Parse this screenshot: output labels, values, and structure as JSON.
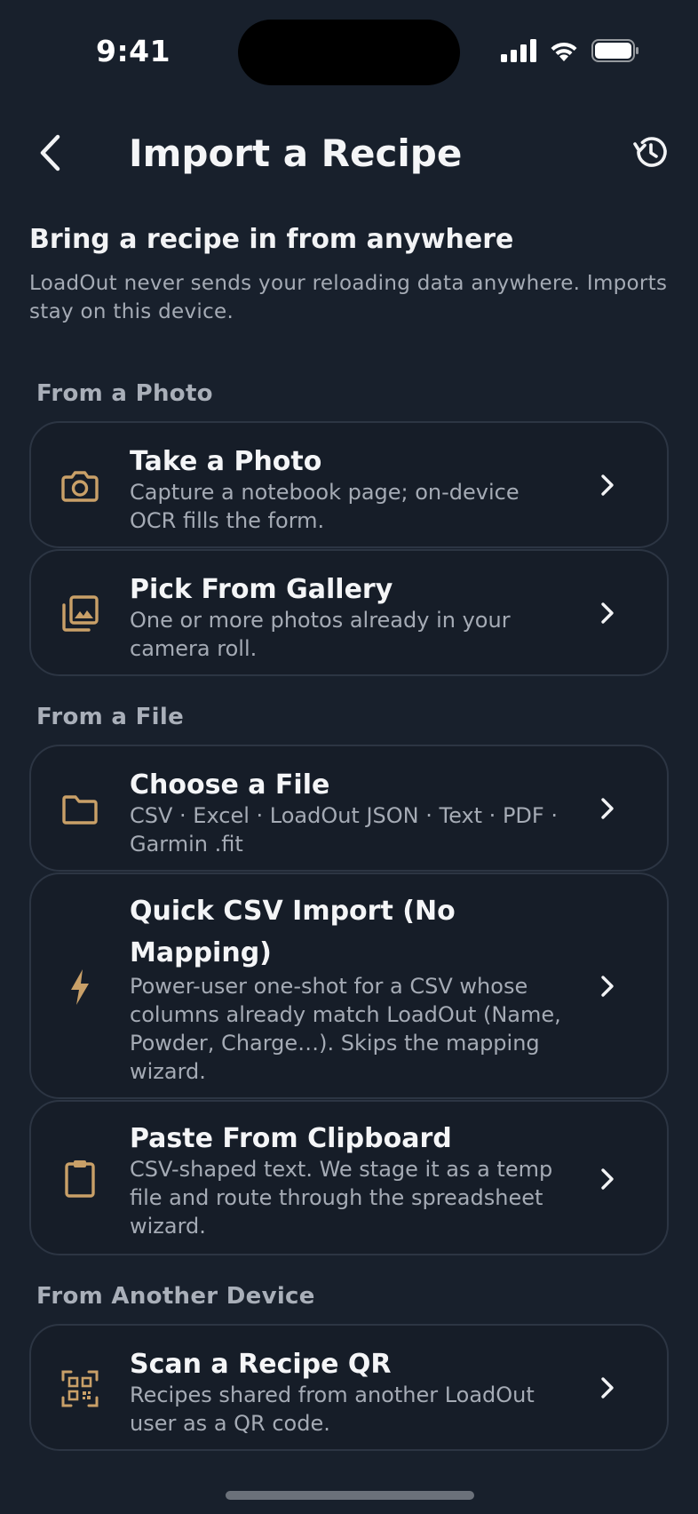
{
  "status_bar": {
    "time": "9:41"
  },
  "nav": {
    "title": "Import a Recipe"
  },
  "intro": {
    "title": "Bring a recipe in from anywhere",
    "body": "LoadOut never sends your reloading data anywhere. Imports stay on this device."
  },
  "sections": [
    {
      "label": "From a Photo"
    },
    {
      "label": "From a File"
    },
    {
      "label": "From Another Device"
    }
  ],
  "options": [
    {
      "icon": "camera-icon",
      "title": "Take a Photo",
      "subtitle": "Capture a notebook page; on-device OCR fills the form."
    },
    {
      "icon": "gallery-icon",
      "title": "Pick From Gallery",
      "subtitle": "One or more photos already in your camera roll."
    },
    {
      "icon": "folder-icon",
      "title": "Choose a File",
      "subtitle": "CSV · Excel · LoadOut JSON · Text · PDF · Garmin .fit"
    },
    {
      "icon": "lightning-bolt-icon",
      "title": "Quick CSV Import (No Mapping)",
      "subtitle": "Power-user one-shot for a CSV whose columns already match LoadOut (Name, Powder, Charge…). Skips the mapping wizard."
    },
    {
      "icon": "clipboard-icon",
      "title": "Paste From Clipboard",
      "subtitle": "CSV-shaped text. We stage it as a temp file and route through the spreadsheet wizard."
    },
    {
      "icon": "qr-code-icon",
      "title": "Scan a Recipe QR",
      "subtitle": "Recipes shared from another LoadOut user as a QR code."
    }
  ],
  "colors": {
    "background": "#18202c",
    "card_background": "#161d28",
    "card_border": "#2c3543",
    "accent_icon": "#c9a068",
    "text_primary": "#f4f5f7",
    "text_secondary": "#a5abb5"
  }
}
